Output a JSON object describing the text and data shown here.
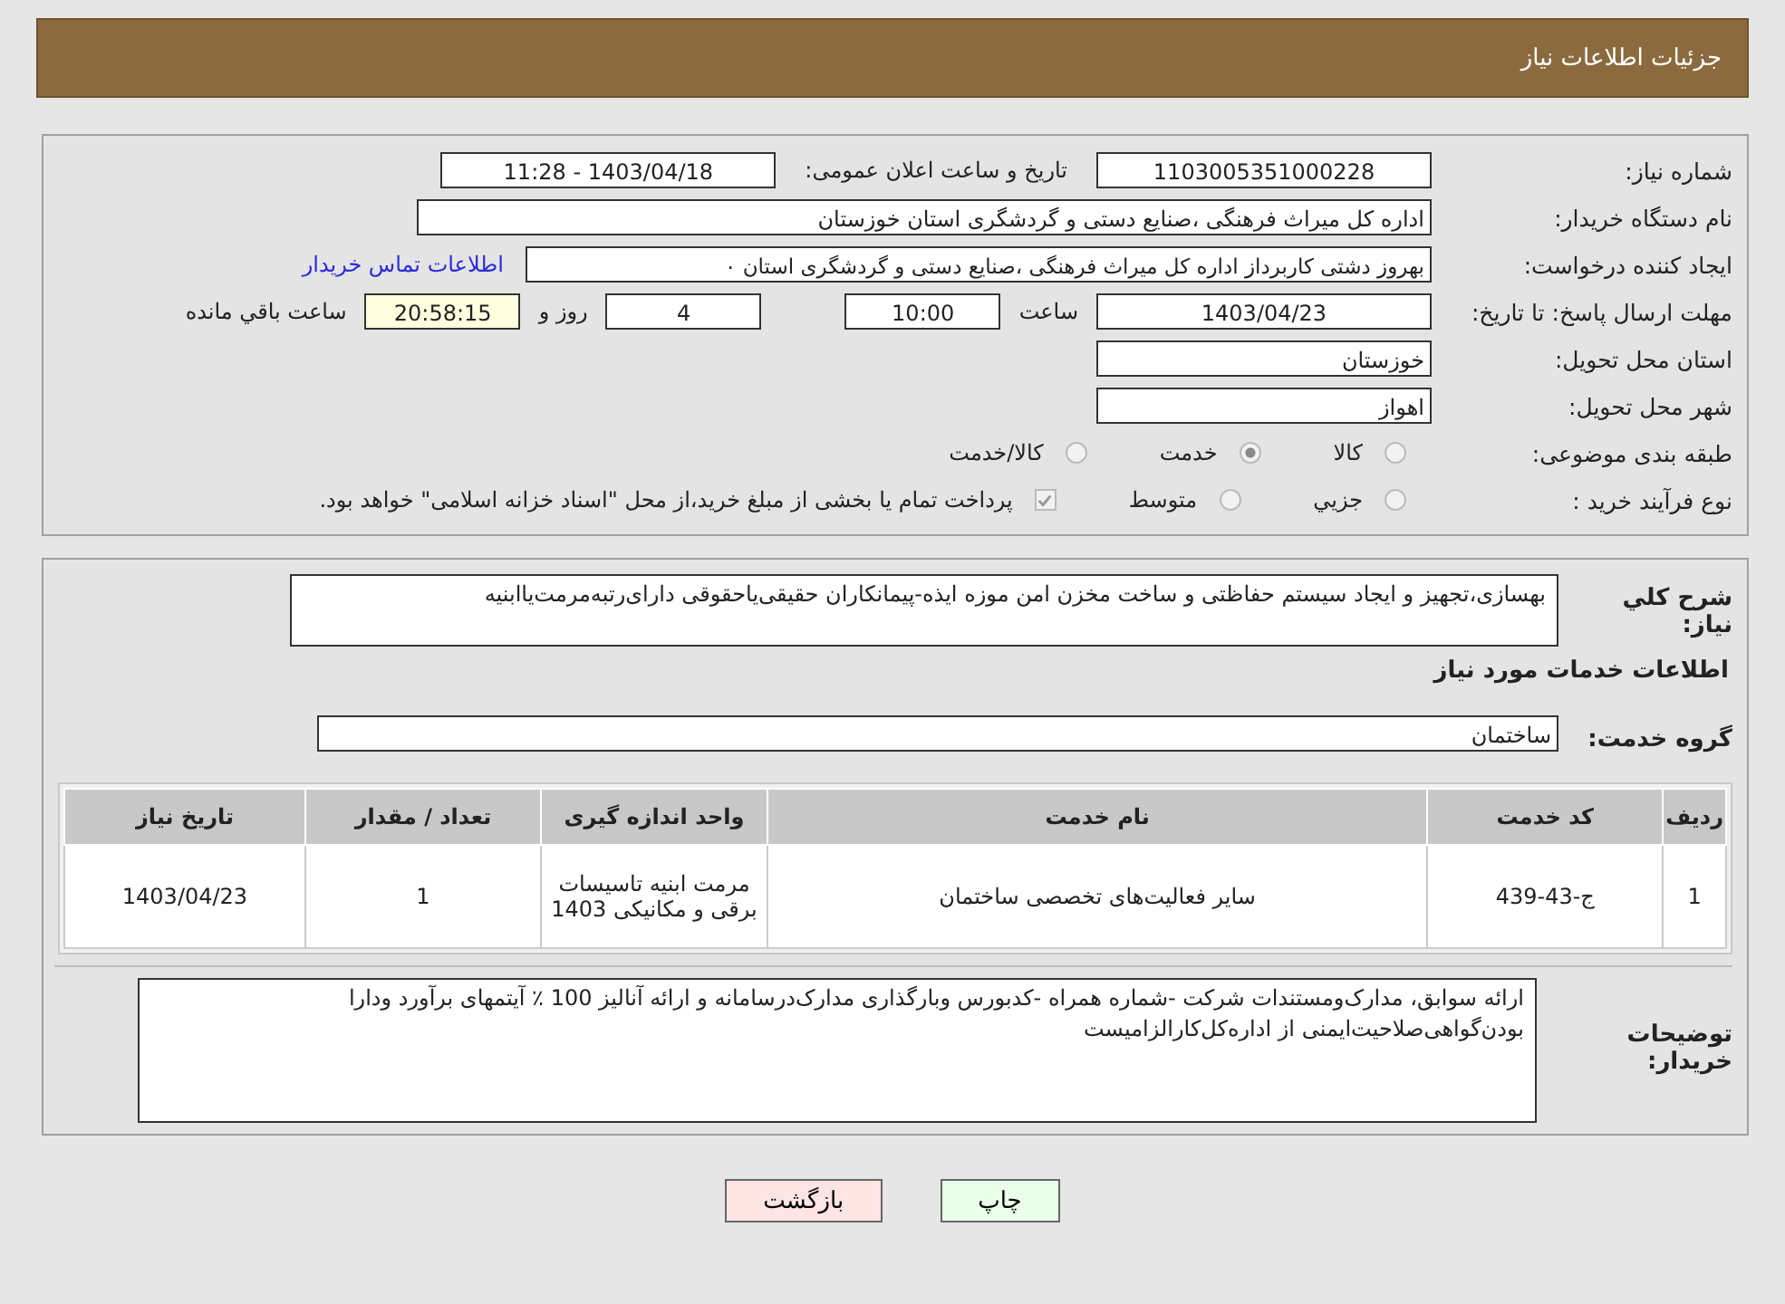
{
  "header": {
    "title": "جزئیات اطلاعات نیاز"
  },
  "details": {
    "need_number": {
      "label": "شماره نیاز:",
      "value": "1103005351000228"
    },
    "announce": {
      "label": "تاریخ و ساعت اعلان عمومی:",
      "value": "1403/04/18 - 11:28"
    },
    "buyer": {
      "label": "نام دستگاه خریدار:",
      "value": "اداره کل میراث فرهنگی ،صنایع دستی و گردشگری استان خوزستان"
    },
    "creator": {
      "label": "ایجاد کننده درخواست:",
      "value": "بهروز دشتی کاربرداز اداره کل میراث فرهنگی ،صنایع دستی و گردشگری استان ٠",
      "link": "اطلاعات تماس خریدار"
    },
    "deadline": {
      "label": "مهلت ارسال پاسخ: تا تاریخ:",
      "date": "1403/04/23",
      "time_label": "ساعت",
      "time": "10:00",
      "days": "4",
      "days_label": "روز و",
      "remaining": "20:58:15",
      "remaining_label": "ساعت باقي مانده"
    },
    "province": {
      "label": "استان محل تحویل:",
      "value": "خوزستان"
    },
    "city": {
      "label": "شهر محل تحویل:",
      "value": "اهواز"
    },
    "category": {
      "label": "طبقه بندی موضوعی:",
      "options": [
        {
          "label": "کالا",
          "selected": false
        },
        {
          "label": "خدمت",
          "selected": true
        },
        {
          "label": "کالا/خدمت",
          "selected": false
        }
      ]
    },
    "process": {
      "label": "نوع فرآیند خرید :",
      "options": [
        {
          "label": "جزيي",
          "selected": false
        },
        {
          "label": "متوسط",
          "selected": false
        }
      ],
      "payment": {
        "checked": true,
        "text": "پرداخت تمام یا بخشی از مبلغ خرید،از محل \"اسناد خزانه اسلامی\" خواهد بود."
      }
    }
  },
  "need": {
    "label": "شرح کلي نیاز:",
    "value": "بهسازی،تجهیز و ایجاد سیستم حفاظتی و ساخت مخزن امن موزه ایذه-پیمانکاران حقیقی‌یاحقوقی دارای‌رتبه‌مرمت‌یاابنیه",
    "section_title": "اطلاعات خدمات مورد نیاز",
    "group_label": "گروه خدمت:",
    "group_value": "ساختمان"
  },
  "table": {
    "columns": [
      "ردیف",
      "کد خدمت",
      "نام خدمت",
      "واحد اندازه گیری",
      "تعداد / مقدار",
      "تاریخ نیاز"
    ],
    "rows": [
      [
        "1",
        "ج-43-439",
        "سایر فعالیت‌های تخصصی ساختمان",
        "مرمت ابنیه تاسیسات برقی و مکانیکی 1403",
        "1",
        "1403/04/23"
      ]
    ]
  },
  "notes": {
    "label": "توضیحات خریدار:",
    "value": "ارائه سوابق، مدارک‌ومستندات شرکت -شماره همراه -کدبورس وبارگذاری مدارک‌درسامانه و ارائه آنالیز 100 ٪ آیتمهای برآورد ودارا بودن‌گواهی‌صلاحیت‌ایمنی از اداره‌کل‌کارالزامیست"
  },
  "buttons": [
    {
      "kind": "print",
      "label": "چاپ"
    },
    {
      "kind": "back",
      "label": "بازگشت"
    }
  ]
}
